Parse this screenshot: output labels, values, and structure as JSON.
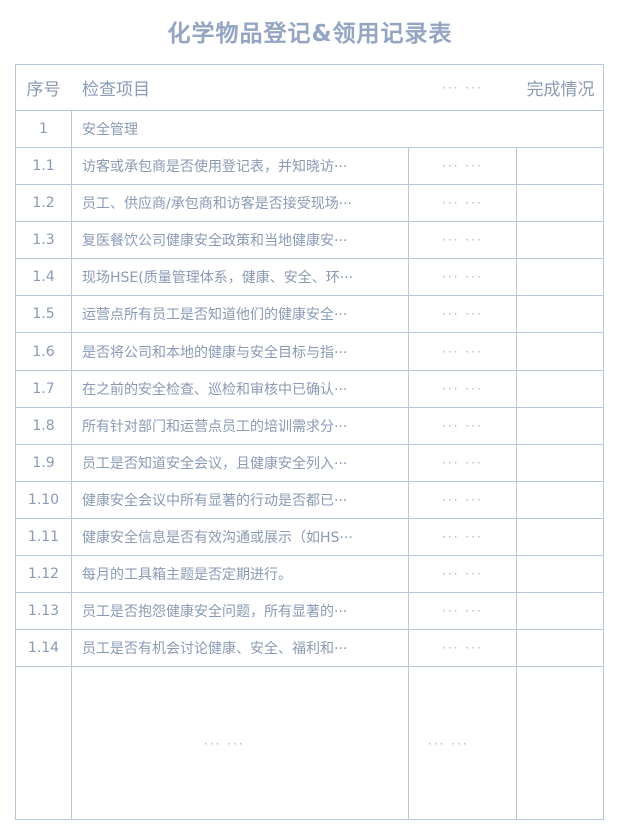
{
  "title": "化学物品登记&领用记录表",
  "header": {
    "num": "序号",
    "item": "检查项目",
    "dots": "··· ···",
    "done": "完成情况"
  },
  "section": {
    "num": "1",
    "label": "安全管理"
  },
  "rows": [
    {
      "num": "1.1",
      "item": "访客或承包商是否使用登记表，并知晓访",
      "dots": "··· ···"
    },
    {
      "num": "1.2",
      "item": "员工、供应商/承包商和访客是否接受现场",
      "dots": "··· ···"
    },
    {
      "num": "1.3",
      "item": "复医餐饮公司健康安全政策和当地健康安",
      "dots": "··· ···"
    },
    {
      "num": "1.4",
      "item": "现场HSE(质量管理体系，健康、安全、环",
      "dots": "··· ···"
    },
    {
      "num": "1.5",
      "item": "运营点所有员工是否知道他们的健康安全",
      "dots": "··· ···"
    },
    {
      "num": "1.6",
      "item": "是否将公司和本地的健康与安全目标与指",
      "dots": "··· ···"
    },
    {
      "num": "1.7",
      "item": "在之前的安全检查、巡检和审核中已确认",
      "dots": "··· ···"
    },
    {
      "num": "1.8",
      "item": "所有针对部门和运营点员工的培训需求分",
      "dots": "··· ···"
    },
    {
      "num": "1.9",
      "item": "员工是否知道安全会议，且健康安全列入",
      "dots": "··· ···"
    },
    {
      "num": "1.10",
      "item": "健康安全会议中所有显著的行动是否都已",
      "dots": "··· ···"
    },
    {
      "num": "1.11",
      "item": "健康安全信息是否有效沟通或展示（如HS",
      "dots": "··· ···"
    },
    {
      "num": "1.12",
      "item": "每月的工具箱主题是否定期进行。",
      "dots": "··· ···"
    },
    {
      "num": "1.13",
      "item": "员工是否抱怨健康安全问题，所有显著的",
      "dots": "··· ···"
    },
    {
      "num": "1.14",
      "item": "员工是否有机会讨论健康、安全、福利和",
      "dots": "··· ···"
    }
  ],
  "blank_row": {
    "item_dots": "··· ···",
    "col_dots": "··· ···"
  },
  "item_truncation": "···"
}
